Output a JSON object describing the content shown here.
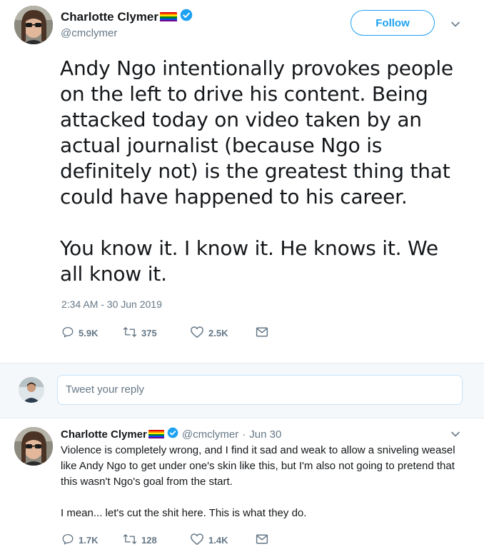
{
  "tweet": {
    "author_name": "Charlotte Clymer",
    "author_handle": "@cmclymer",
    "follow_label": "Follow",
    "text": "Andy Ngo intentionally provokes people on the left to drive his content. Being attacked today on video taken by an actual journalist (because Ngo is definitely not) is the greatest thing that could have happened to his career.\n\nYou know it. I know it. He knows it. We all know it.",
    "timestamp": "2:34 AM - 30 Jun 2019",
    "replies": "5.9K",
    "retweets": "375",
    "likes": "2.5K"
  },
  "reply_box": {
    "placeholder": "Tweet your reply"
  },
  "reply": {
    "author_name": "Charlotte Clymer",
    "author_handle": "@cmclymer",
    "separator": "·",
    "date": "Jun 30",
    "text": "Violence is completely wrong, and I find it sad and weak to allow a sniveling weasel like Andy Ngo to get under one's skin like this, but I'm also not going to pretend that this wasn't Ngo's goal from the start.\n\nI mean... let's cut the shit here. This is what they do.",
    "replies": "1.7K",
    "retweets": "128",
    "likes": "1.4K"
  },
  "icons": {
    "reply": "reply-icon",
    "retweet": "retweet-icon",
    "like": "heart-icon",
    "dm": "envelope-icon",
    "verified": "verified-badge-icon",
    "flag": "rainbow-flag-icon",
    "caret": "chevron-down-icon"
  },
  "colors": {
    "accent": "#1da1f2",
    "muted": "#657786",
    "text": "#14171a",
    "reply_bg": "#f5f8fa"
  }
}
